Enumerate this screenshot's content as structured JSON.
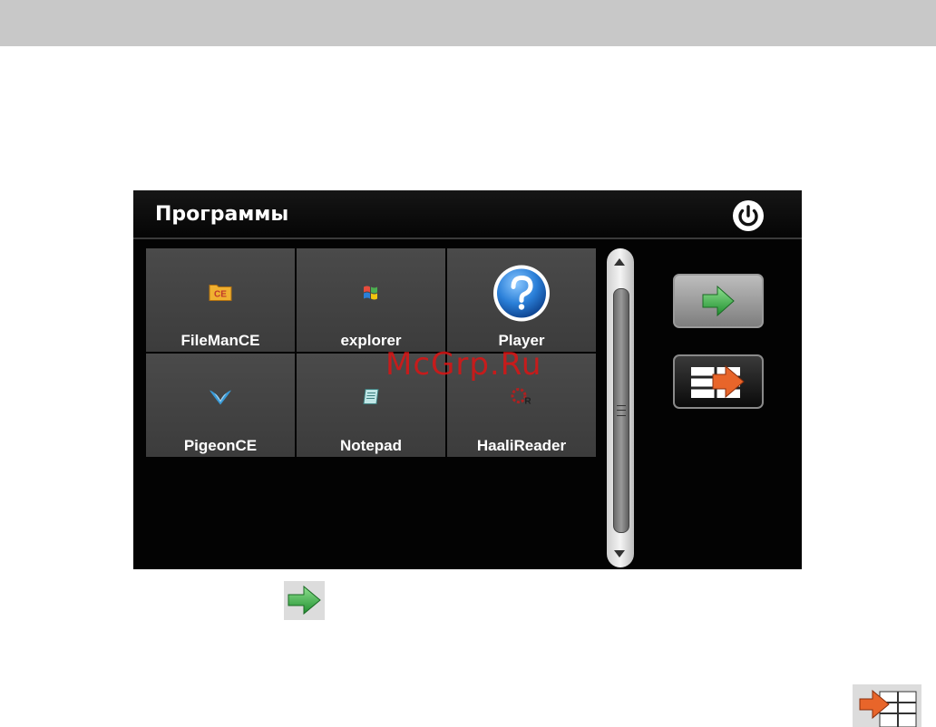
{
  "window": {
    "title": "Программы"
  },
  "apps": [
    {
      "label": "FileManCE",
      "icon": "filemance-icon"
    },
    {
      "label": "explorer",
      "icon": "windows-flag-icon"
    },
    {
      "label": "Player",
      "icon": "help-question-icon"
    },
    {
      "label": "PigeonCE",
      "icon": "pigeon-icon"
    },
    {
      "label": "Notepad",
      "icon": "notepad-icon"
    },
    {
      "label": "HaaliReader",
      "icon": "haali-reader-icon"
    }
  ],
  "icons": {
    "filemance_badge": "CE",
    "haali_badge": "R"
  },
  "buttons": {
    "power": "power-icon",
    "next": "green-arrow-right-icon",
    "exit": "exit-grid-icon"
  },
  "watermark": "McGrp.Ru",
  "colors": {
    "screen_background": "#030303",
    "tile": "#444444",
    "accent_green": "#3cb33c",
    "accent_orange": "#e8652a",
    "help_blue": "#2a7fd8",
    "top_bar": "#c8c8c8"
  }
}
